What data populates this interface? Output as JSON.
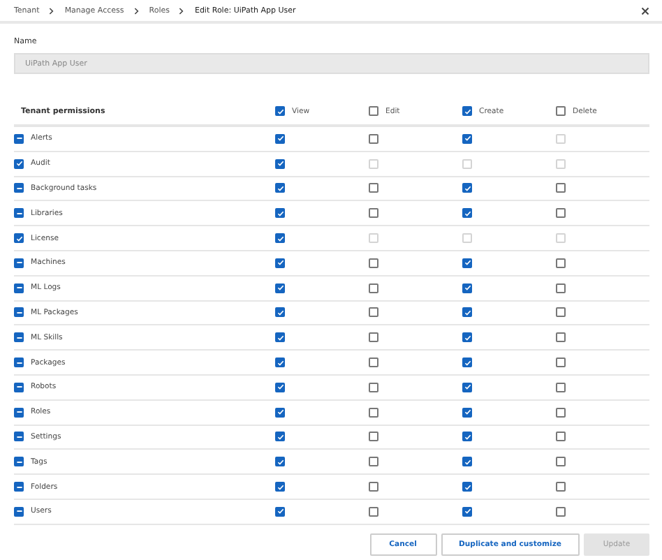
{
  "breadcrumb": [
    "Tenant",
    "Manage Access",
    "Roles",
    "Edit Role: UiPath App User"
  ],
  "name_field": {
    "label": "Name",
    "value": "UiPath App User",
    "disabled": true
  },
  "table": {
    "title": "Tenant permissions",
    "columns": [
      {
        "label": "View",
        "checked": true
      },
      {
        "label": "Edit",
        "checked": false
      },
      {
        "label": "Create",
        "checked": true
      },
      {
        "label": "Delete",
        "checked": false
      }
    ],
    "rows": [
      {
        "label": "Alerts",
        "indeterminate": true,
        "cells": [
          {
            "checked": true,
            "disabled": false
          },
          {
            "checked": false,
            "disabled": false
          },
          {
            "checked": true,
            "disabled": false
          },
          {
            "checked": false,
            "disabled": true
          }
        ]
      },
      {
        "label": "Audit",
        "checked": true,
        "indeterminate": false,
        "cells": [
          {
            "checked": true,
            "disabled": false
          },
          {
            "checked": false,
            "disabled": true
          },
          {
            "checked": false,
            "disabled": true
          },
          {
            "checked": false,
            "disabled": true
          }
        ]
      },
      {
        "label": "Background tasks",
        "indeterminate": true,
        "cells": [
          {
            "checked": true,
            "disabled": false
          },
          {
            "checked": false,
            "disabled": false
          },
          {
            "checked": true,
            "disabled": false
          },
          {
            "checked": false,
            "disabled": false
          }
        ]
      },
      {
        "label": "Libraries",
        "indeterminate": true,
        "cells": [
          {
            "checked": true,
            "disabled": false
          },
          {
            "checked": false,
            "disabled": false
          },
          {
            "checked": true,
            "disabled": false
          },
          {
            "checked": false,
            "disabled": false
          }
        ]
      },
      {
        "label": "License",
        "checked": true,
        "indeterminate": false,
        "cells": [
          {
            "checked": true,
            "disabled": false
          },
          {
            "checked": false,
            "disabled": true
          },
          {
            "checked": false,
            "disabled": true
          },
          {
            "checked": false,
            "disabled": true
          }
        ]
      },
      {
        "label": "Machines",
        "indeterminate": true,
        "cells": [
          {
            "checked": true,
            "disabled": false
          },
          {
            "checked": false,
            "disabled": false
          },
          {
            "checked": true,
            "disabled": false
          },
          {
            "checked": false,
            "disabled": false
          }
        ]
      },
      {
        "label": "ML Logs",
        "indeterminate": true,
        "cells": [
          {
            "checked": true,
            "disabled": false
          },
          {
            "checked": false,
            "disabled": false
          },
          {
            "checked": true,
            "disabled": false
          },
          {
            "checked": false,
            "disabled": false
          }
        ]
      },
      {
        "label": "ML Packages",
        "indeterminate": true,
        "cells": [
          {
            "checked": true,
            "disabled": false
          },
          {
            "checked": false,
            "disabled": false
          },
          {
            "checked": true,
            "disabled": false
          },
          {
            "checked": false,
            "disabled": false
          }
        ]
      },
      {
        "label": "ML Skills",
        "indeterminate": true,
        "cells": [
          {
            "checked": true,
            "disabled": false
          },
          {
            "checked": false,
            "disabled": false
          },
          {
            "checked": true,
            "disabled": false
          },
          {
            "checked": false,
            "disabled": false
          }
        ]
      },
      {
        "label": "Packages",
        "indeterminate": true,
        "cells": [
          {
            "checked": true,
            "disabled": false
          },
          {
            "checked": false,
            "disabled": false
          },
          {
            "checked": true,
            "disabled": false
          },
          {
            "checked": false,
            "disabled": false
          }
        ]
      },
      {
        "label": "Robots",
        "indeterminate": true,
        "cells": [
          {
            "checked": true,
            "disabled": false
          },
          {
            "checked": false,
            "disabled": false
          },
          {
            "checked": true,
            "disabled": false
          },
          {
            "checked": false,
            "disabled": false
          }
        ]
      },
      {
        "label": "Roles",
        "indeterminate": true,
        "cells": [
          {
            "checked": true,
            "disabled": false
          },
          {
            "checked": false,
            "disabled": false
          },
          {
            "checked": true,
            "disabled": false
          },
          {
            "checked": false,
            "disabled": false
          }
        ]
      },
      {
        "label": "Settings",
        "indeterminate": true,
        "cells": [
          {
            "checked": true,
            "disabled": false
          },
          {
            "checked": false,
            "disabled": false
          },
          {
            "checked": true,
            "disabled": false
          },
          {
            "checked": false,
            "disabled": false
          }
        ]
      },
      {
        "label": "Tags",
        "indeterminate": true,
        "cells": [
          {
            "checked": true,
            "disabled": false
          },
          {
            "checked": false,
            "disabled": false
          },
          {
            "checked": true,
            "disabled": false
          },
          {
            "checked": false,
            "disabled": false
          }
        ]
      },
      {
        "label": "Folders",
        "indeterminate": true,
        "cells": [
          {
            "checked": true,
            "disabled": false
          },
          {
            "checked": false,
            "disabled": false
          },
          {
            "checked": true,
            "disabled": false
          },
          {
            "checked": false,
            "disabled": false
          }
        ]
      },
      {
        "label": "Users",
        "indeterminate": true,
        "cells": [
          {
            "checked": true,
            "disabled": false
          },
          {
            "checked": false,
            "disabled": false
          },
          {
            "checked": true,
            "disabled": false
          },
          {
            "checked": false,
            "disabled": false
          }
        ]
      }
    ]
  },
  "buttons": [
    {
      "label": "Cancel",
      "kind": "secondary",
      "disabled": false
    },
    {
      "label": "Duplicate and customize",
      "kind": "secondary",
      "disabled": false
    },
    {
      "label": "Update",
      "kind": "primary",
      "disabled": true
    }
  ]
}
